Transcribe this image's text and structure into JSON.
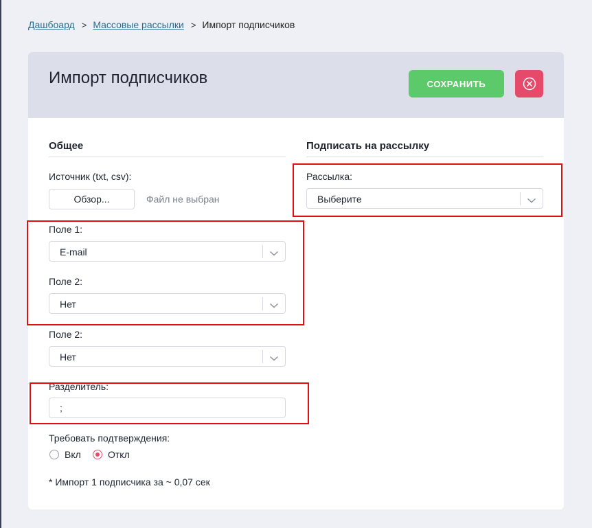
{
  "breadcrumb": {
    "items": [
      "Дашбоард",
      "Массовые рассылки"
    ],
    "separator": ">",
    "current": "Импорт подписчиков"
  },
  "header": {
    "title": "Импорт подписчиков",
    "save_label": "СОХРАНИТЬ",
    "close_icon": "close-circle-icon"
  },
  "general": {
    "title": "Общее",
    "source_label": "Источник (txt, csv):",
    "browse_label": "Обзор...",
    "file_status": "Файл не выбран",
    "field1_label": "Поле 1:",
    "field1_value": "E-mail",
    "field2_label": "Поле 2:",
    "field2_value": "Нет",
    "field3_label": "Поле 2:",
    "field3_value": "Нет",
    "separator_label": "Разделитель:",
    "separator_value": ";",
    "confirm_label": "Требовать подтверждения:",
    "confirm_options": [
      "Вкл",
      "Откл"
    ],
    "confirm_selected": "Откл",
    "note": "* Импорт 1 подписчика за ~ 0,07 сек"
  },
  "subscribe": {
    "title": "Подписать на рассылку",
    "mailing_label": "Рассылка:",
    "mailing_value": "Выберите"
  },
  "colors": {
    "accent_green": "#5cc96a",
    "accent_red": "#e64a6a",
    "link": "#2a6d8f",
    "highlight": "#e01010"
  }
}
